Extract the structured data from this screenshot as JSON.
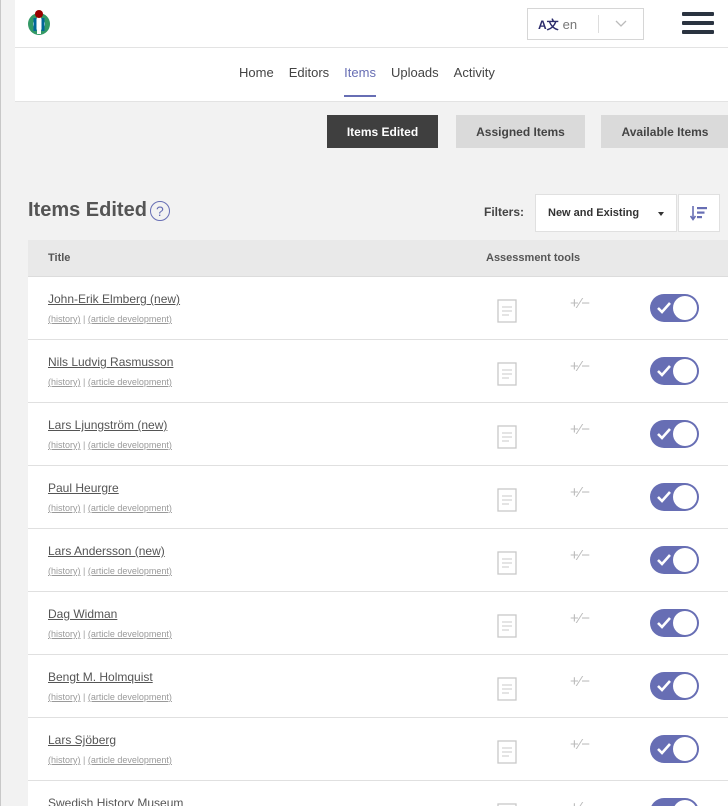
{
  "header": {
    "lang_icon": "A文",
    "lang_value": "en"
  },
  "nav": {
    "items": [
      {
        "label": "Home"
      },
      {
        "label": "Editors"
      },
      {
        "label": "Items"
      },
      {
        "label": "Uploads"
      },
      {
        "label": "Activity"
      }
    ],
    "active": "Items"
  },
  "tabs": {
    "items_edited": "Items Edited",
    "assigned_items": "Assigned Items",
    "available_items": "Available Items"
  },
  "section": {
    "title": "Items Edited",
    "help_symbol": "?"
  },
  "filters": {
    "label": "Filters:",
    "selected": "New and Existing"
  },
  "table": {
    "columns": {
      "title": "Title",
      "tools": "Assessment tools"
    },
    "link_history": "(history)",
    "link_separator": " | ",
    "link_article_dev": "(article development)",
    "diff_symbol": "+⁄−",
    "rows": [
      {
        "title": "John-Erik Elmberg (new)"
      },
      {
        "title": "Nils Ludvig Rasmusson"
      },
      {
        "title": "Lars Ljungström (new)"
      },
      {
        "title": "Paul Heurgre"
      },
      {
        "title": "Lars Andersson (new)"
      },
      {
        "title": "Dag Widman"
      },
      {
        "title": "Bengt M. Holmquist"
      },
      {
        "title": "Lars Sjöberg"
      },
      {
        "title": "Swedish History Museum"
      }
    ]
  },
  "colors": {
    "accent": "#676eb4",
    "dark_button": "#3f3f3f"
  }
}
